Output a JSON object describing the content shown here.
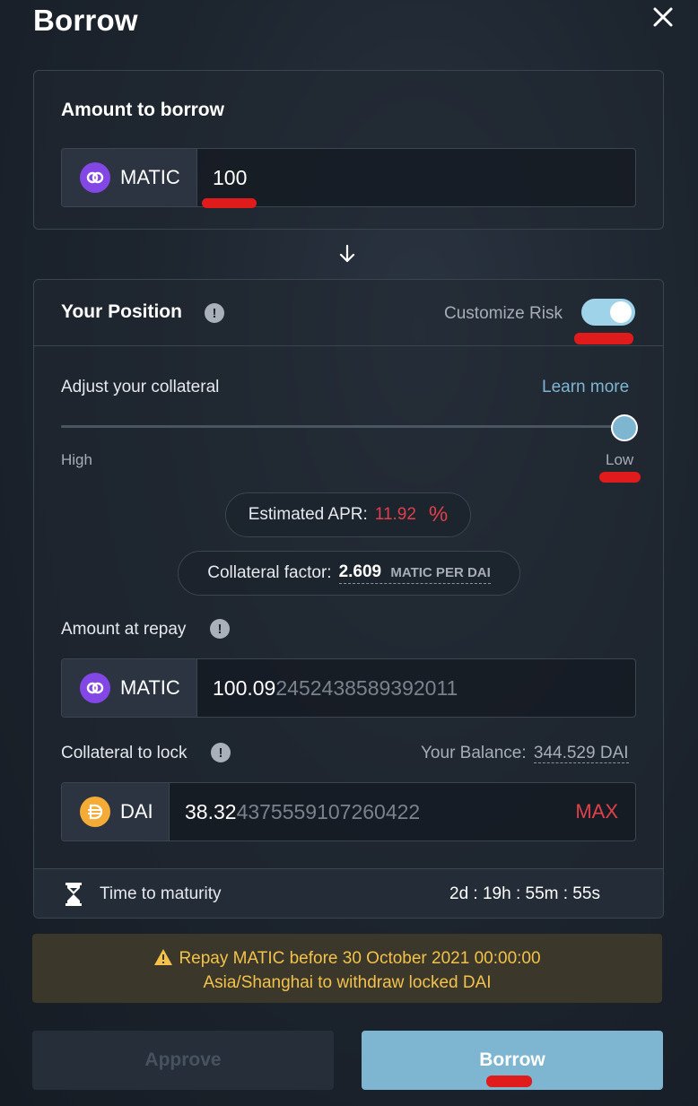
{
  "header": {
    "title": "Borrow"
  },
  "borrow": {
    "section_title": "Amount to borrow",
    "token": "MATIC",
    "amount": "100"
  },
  "position": {
    "section_title": "Your Position",
    "customize_risk_label": "Customize Risk",
    "customize_risk_enabled": true,
    "collateral_label": "Adjust your collateral",
    "learn_more": "Learn more",
    "slider_min_label": "High",
    "slider_max_label": "Low",
    "slider_level": 1.0,
    "apr_label": "Estimated APR:",
    "apr_value": "11.92",
    "apr_unit": "%",
    "collateral_factor_label": "Collateral factor:",
    "collateral_factor_value": "2.609",
    "collateral_factor_unit": "MATIC PER DAI",
    "repay_label": "Amount at repay",
    "repay_token": "MATIC",
    "repay_value_main": "100.09",
    "repay_value_rest": "2452438589392011",
    "lock_label": "Collateral to lock",
    "balance_label": "Your Balance:",
    "balance_value": "344.529 DAI",
    "lock_token": "DAI",
    "lock_value_main": "38.32",
    "lock_value_rest": "4375559107260422",
    "max_label": "MAX",
    "maturity_label": "Time to maturity",
    "maturity_value": "2d : 19h : 55m : 55s"
  },
  "warning": {
    "line1": "Repay MATIC before 30 October 2021 00:00:00",
    "line2": "Asia/Shanghai to withdraw locked DAI"
  },
  "actions": {
    "approve_label": "Approve",
    "borrow_label": "Borrow"
  },
  "colors": {
    "accent": "#7eb6d2",
    "matic": "#8247e5",
    "dai": "#f5ac37",
    "danger": "#e0404a",
    "warning_text": "#f3c24a"
  }
}
